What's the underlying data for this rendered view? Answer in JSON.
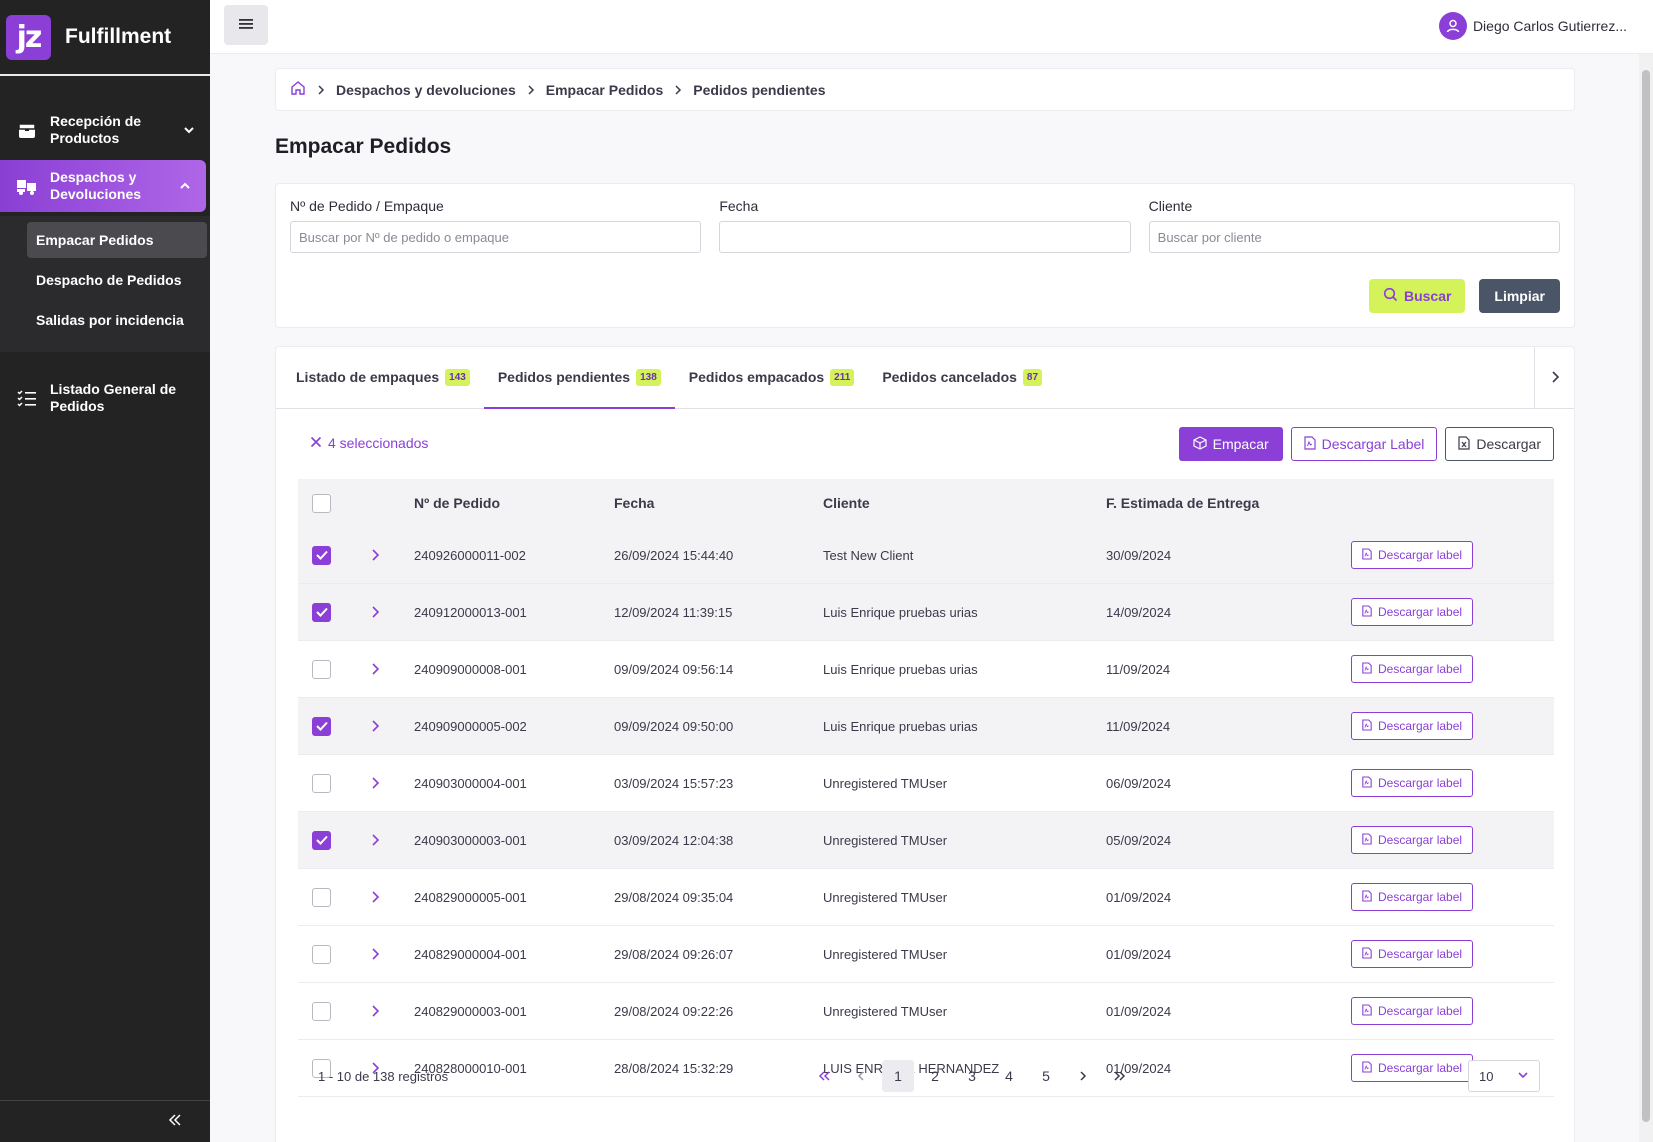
{
  "app": {
    "logo_text": "jz",
    "name": "Fulfillment"
  },
  "sidebar": {
    "items": [
      {
        "label": "Recepción de Productos",
        "icon": "package-icon",
        "chevron": "down"
      },
      {
        "label": "Despachos y Devoluciones",
        "icon": "truck-icon",
        "chevron": "up",
        "active": true
      },
      {
        "label": "Listado General de Pedidos",
        "icon": "list-icon"
      }
    ],
    "subitems": [
      "Empacar Pedidos",
      "Despacho de Pedidos",
      "Salidas por incidencia"
    ],
    "current_subitem": "Empacar Pedidos",
    "collapse_icon": "double-chevron-left-icon"
  },
  "topbar": {
    "menu_icon": "hamburger-icon",
    "user_name": "Diego Carlos Gutierrez..."
  },
  "breadcrumb": [
    "Despachos y devoluciones",
    "Empacar Pedidos",
    "Pedidos pendientes"
  ],
  "page_title": "Empacar Pedidos",
  "filters": {
    "order_label": "Nº de Pedido / Empaque",
    "order_placeholder": "Buscar por Nº de pedido o empaque",
    "date_label": "Fecha",
    "date_placeholder": "",
    "client_label": "Cliente",
    "client_placeholder": "Buscar por cliente",
    "search_button": "Buscar",
    "clear_button": "Limpiar"
  },
  "tabs": [
    {
      "label": "Listado de empaques",
      "count": "143"
    },
    {
      "label": "Pedidos pendientes",
      "count": "138",
      "active": true
    },
    {
      "label": "Pedidos empacados",
      "count": "211"
    },
    {
      "label": "Pedidos cancelados",
      "count": "87"
    }
  ],
  "actions": {
    "selected_text": "4 seleccionados",
    "pack_button": "Empacar",
    "download_label_button": "Descargar Label",
    "download_button": "Descargar"
  },
  "table": {
    "headers": {
      "order": "Nº de Pedido",
      "date": "Fecha",
      "client": "Cliente",
      "eta": "F. Estimada de Entrega"
    },
    "row_action_label": "Descargar label",
    "rows": [
      {
        "order": "240926000011-002",
        "date": "26/09/2024 15:44:40",
        "client": "Test New Client",
        "eta": "30/09/2024",
        "checked": true
      },
      {
        "order": "240912000013-001",
        "date": "12/09/2024 11:39:15",
        "client": "Luis Enrique pruebas urias",
        "eta": "14/09/2024",
        "checked": true
      },
      {
        "order": "240909000008-001",
        "date": "09/09/2024 09:56:14",
        "client": "Luis Enrique pruebas urias",
        "eta": "11/09/2024",
        "checked": false
      },
      {
        "order": "240909000005-002",
        "date": "09/09/2024 09:50:00",
        "client": "Luis Enrique pruebas urias",
        "eta": "11/09/2024",
        "checked": true
      },
      {
        "order": "240903000004-001",
        "date": "03/09/2024 15:57:23",
        "client": "Unregistered TMUser",
        "eta": "06/09/2024",
        "checked": false
      },
      {
        "order": "240903000003-001",
        "date": "03/09/2024 12:04:38",
        "client": "Unregistered TMUser",
        "eta": "05/09/2024",
        "checked": true
      },
      {
        "order": "240829000005-001",
        "date": "29/08/2024 09:35:04",
        "client": "Unregistered TMUser",
        "eta": "01/09/2024",
        "checked": false
      },
      {
        "order": "240829000004-001",
        "date": "29/08/2024 09:26:07",
        "client": "Unregistered TMUser",
        "eta": "01/09/2024",
        "checked": false
      },
      {
        "order": "240829000003-001",
        "date": "29/08/2024 09:22:26",
        "client": "Unregistered TMUser",
        "eta": "01/09/2024",
        "checked": false
      },
      {
        "order": "240828000010-001",
        "date": "28/08/2024 15:32:29",
        "client": "LUIS ENRIQUE HERNANDEZ",
        "eta": "01/09/2024",
        "checked": false
      }
    ]
  },
  "pagination": {
    "range_text": "1 - 10 de 138 registros",
    "pages": [
      "1",
      "2",
      "3",
      "4",
      "5"
    ],
    "current_page": "1",
    "per_page": "10"
  },
  "colors": {
    "accent": "#8b3fd6",
    "lime": "#d4f25a",
    "sidebar_bg": "#232323",
    "slate": "#4b5568"
  }
}
